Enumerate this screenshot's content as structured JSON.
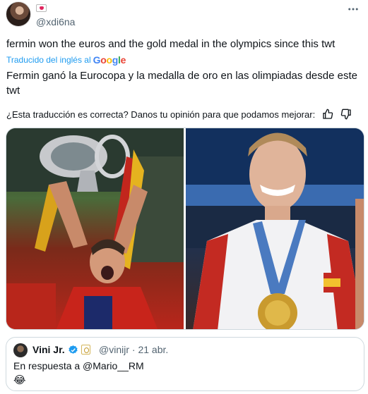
{
  "author": {
    "handle": "@xdi6na",
    "name_emoji": "💌"
  },
  "tweet": {
    "text": "fermin won the euros and the gold medal in the olympics since this twt",
    "translated_by_label": "Traducido del inglés al",
    "translator_logo_text": "Google",
    "translation": "Fermin ganó la Eurocopa y la medalla de oro en las olimpiadas desde este twt",
    "feedback_prompt": "¿Esta traducción es correcta? Danos tu opinión para que podamos mejorar:"
  },
  "media": {
    "photos": [
      {
        "name": "euro-trophy-celebration-photo"
      },
      {
        "name": "olympic-gold-medal-photo"
      }
    ]
  },
  "quoted_tweet": {
    "name": "Vini Jr.",
    "handle": "@vinijr",
    "separator": "·",
    "date": "21 abr.",
    "reply_text": "En respuesta a @Mario__RM",
    "emoji": "😂"
  },
  "icons": {
    "more": "more-options-icon",
    "thumbs_up": "thumbs-up-icon",
    "thumbs_down": "thumbs-down-icon",
    "verified": "verified-badge-icon"
  },
  "colors": {
    "link_blue": "#1d9bf0",
    "secondary_text": "#536471",
    "border": "#cfd9de"
  }
}
